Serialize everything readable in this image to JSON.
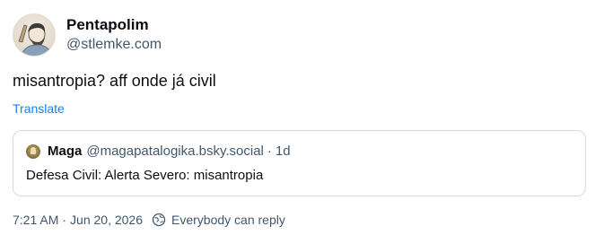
{
  "author": {
    "display_name": "Pentapolim",
    "handle": "@stlemke.com"
  },
  "post": {
    "text": "misantropia? aff onde já civil",
    "translate_label": "Translate"
  },
  "quote": {
    "display_name": "Maga",
    "handle": "@magapatalogika.bsky.social",
    "separator": "·",
    "time": "1d",
    "text": "Defesa Civil: Alerta Severo: misantropia"
  },
  "meta": {
    "time": "7:21 AM",
    "separator": "·",
    "date": "Jun 20, 2026",
    "reply_setting": "Everybody can reply"
  },
  "colors": {
    "accent": "#1083fe",
    "muted": "#42576c",
    "text": "#0b0f14",
    "border": "#d4dbe2"
  },
  "icons": {
    "reply_setting": "earth-reply-icon"
  }
}
